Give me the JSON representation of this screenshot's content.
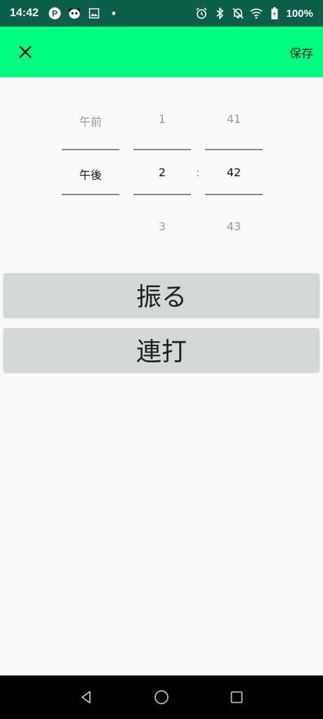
{
  "status_bar": {
    "time": "14:42",
    "battery": "100%",
    "icons": [
      "p-icon",
      "panda-icon",
      "image-icon",
      "dot-icon",
      "alarm-icon",
      "bluetooth-icon",
      "mute-icon",
      "wifi-icon",
      "battery-icon"
    ]
  },
  "app_bar": {
    "save_label": "保存"
  },
  "picker": {
    "ampm": {
      "prev": "午前",
      "selected": "午後"
    },
    "hour": {
      "prev": "1",
      "selected": "2",
      "next": "3"
    },
    "separator": ":",
    "minute": {
      "prev": "41",
      "selected": "42",
      "next": "43"
    }
  },
  "buttons": {
    "shake_label": "振る",
    "tap_label": "連打"
  },
  "colors": {
    "status_bar": "#0b5f49",
    "app_bar": "#00ff7f",
    "button_bg": "#d6d7d7"
  }
}
